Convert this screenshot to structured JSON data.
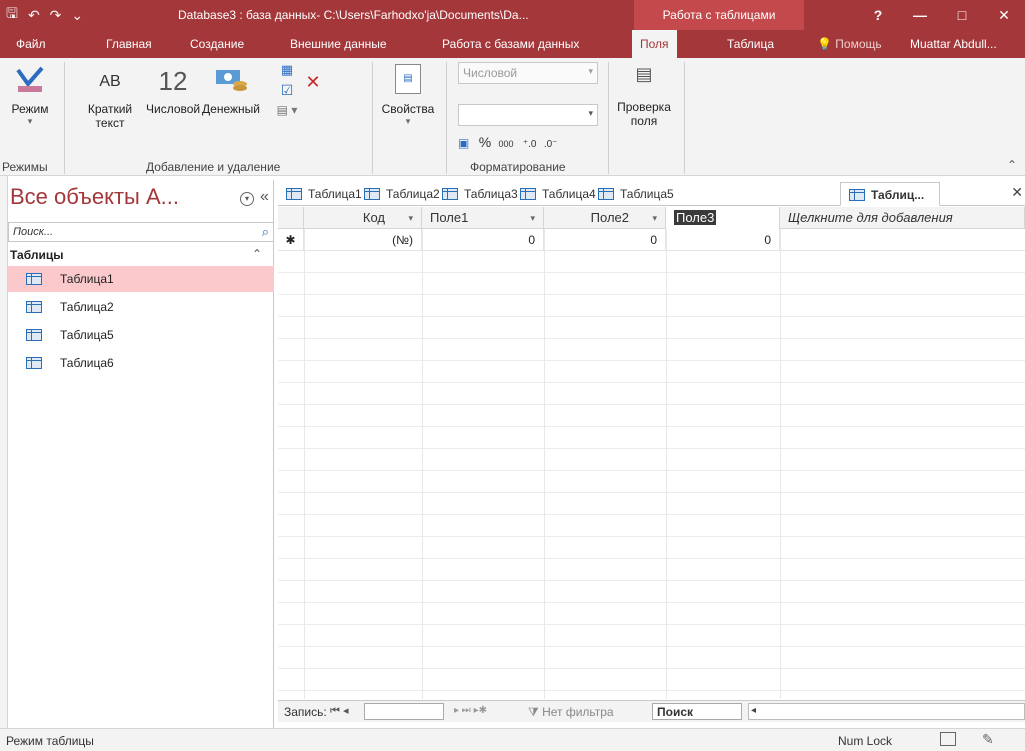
{
  "window": {
    "title": "Database3 : база данных- C:\\Users\\Farhodxo'ja\\Documents\\Da...",
    "context_tab": "Работа с таблицами",
    "buttons": [
      "?",
      "—",
      "□",
      "✕"
    ]
  },
  "ribbon_tabs": [
    {
      "label": "Файл"
    },
    {
      "label": "Главная"
    },
    {
      "label": "Создание"
    },
    {
      "label": "Внешние данные"
    },
    {
      "label": "Работа с базами данных"
    },
    {
      "label": "Поля"
    },
    {
      "label": "Таблица"
    }
  ],
  "help_label": "Помощь",
  "user_name": "Muattar Abdull...",
  "ribbon": {
    "mode_label": "Режим",
    "ab_label": "AB",
    "short_text_label": "Краткий текст",
    "num_big": "12",
    "number_label": "Числовой",
    "currency_label": "Денежный",
    "properties_label": "Свойства",
    "format_value": "Числовой",
    "percent_label": "%",
    "thousands_label": "000",
    "validation_label": "Проверка поля",
    "groups": {
      "modes": "Режимы",
      "add_delete": "Добавление и удаление",
      "formatting": "Форматирование"
    }
  },
  "nav": {
    "title": "Все объекты А...",
    "search_placeholder": "Поиск...",
    "section": "Таблицы",
    "items": [
      {
        "label": "Таблица1",
        "selected": true
      },
      {
        "label": "Таблица2",
        "selected": false
      },
      {
        "label": "Таблица5",
        "selected": false
      },
      {
        "label": "Таблица6",
        "selected": false
      }
    ]
  },
  "doc_tabs": [
    {
      "label": "Таблица1"
    },
    {
      "label": "Таблица2"
    },
    {
      "label": "Таблица3"
    },
    {
      "label": "Таблица4"
    },
    {
      "label": "Таблица5"
    },
    {
      "label": "Таблиц..."
    }
  ],
  "grid": {
    "columns": [
      "Код",
      "Поле1",
      "Поле2",
      "Поле3",
      "Щелкните для добавления"
    ],
    "row_marker": "✱",
    "new_row": [
      "(№)",
      "0",
      "0",
      "0"
    ]
  },
  "record_nav": {
    "label": "Запись:",
    "filter": "Нет фильтра",
    "search": "Поиск"
  },
  "status": {
    "mode": "Режим таблицы",
    "numlock": "Num Lock"
  }
}
